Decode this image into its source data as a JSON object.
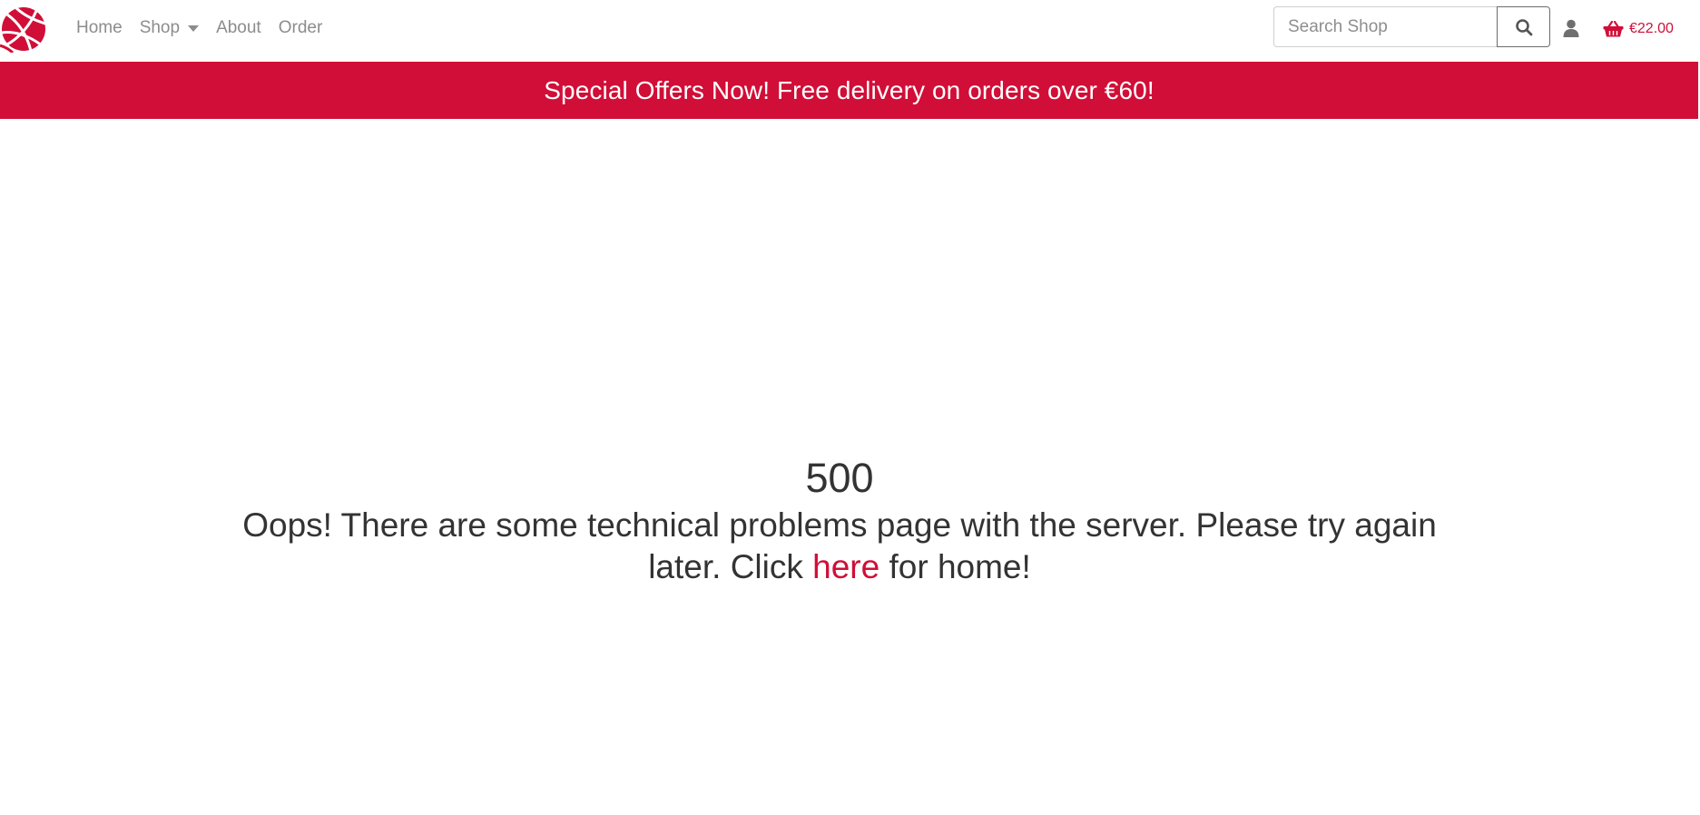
{
  "brand": {
    "logo_icon": "basketball-logo-icon",
    "accent_color": "#d10e37"
  },
  "nav": {
    "items": [
      {
        "label": "Home"
      },
      {
        "label": "Shop",
        "has_dropdown": true
      },
      {
        "label": "About"
      },
      {
        "label": "Order"
      }
    ]
  },
  "search": {
    "placeholder": "Search Shop",
    "value": "",
    "button_icon": "search-icon"
  },
  "account": {
    "icon": "user-icon"
  },
  "basket": {
    "icon": "basket-icon",
    "total": "€22.00"
  },
  "banner": {
    "text": "Special Offers Now! Free delivery on orders over €60!",
    "background": "#d10e37"
  },
  "error": {
    "code": "500",
    "message_before": "Oops! There are some technical problems page with the server. Please try again later. Click",
    "link_text": "here",
    "message_after": "for home!"
  }
}
